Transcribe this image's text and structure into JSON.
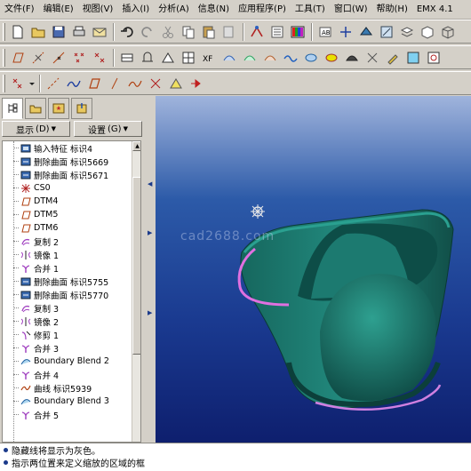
{
  "menu": [
    "文件(F)",
    "编辑(E)",
    "视图(V)",
    "插入(I)",
    "分析(A)",
    "信息(N)",
    "应用程序(P)",
    "工具(T)",
    "窗口(W)",
    "帮助(H)",
    "EMX 4.1"
  ],
  "panel": {
    "display_label": "显示",
    "display_accel": "(D)",
    "settings_label": "设置",
    "settings_accel": "(G)"
  },
  "tree": [
    {
      "label": "输入特征 标识4",
      "icon": "import-feature-icon"
    },
    {
      "label": "删除曲面 标识5669",
      "icon": "delete-surface-icon"
    },
    {
      "label": "删除曲面 标识5671",
      "icon": "delete-surface-icon"
    },
    {
      "label": "CS0",
      "icon": "coordinate-system-icon"
    },
    {
      "label": "DTM4",
      "icon": "datum-plane-icon"
    },
    {
      "label": "DTM5",
      "icon": "datum-plane-icon"
    },
    {
      "label": "DTM6",
      "icon": "datum-plane-icon"
    },
    {
      "label": "复制 2",
      "icon": "copy-icon"
    },
    {
      "label": "镜像 1",
      "icon": "mirror-icon"
    },
    {
      "label": "合并 1",
      "icon": "merge-icon"
    },
    {
      "label": "删除曲面 标识5755",
      "icon": "delete-surface-icon"
    },
    {
      "label": "删除曲面 标识5770",
      "icon": "delete-surface-icon"
    },
    {
      "label": "复制 3",
      "icon": "copy-icon"
    },
    {
      "label": "镜像 2",
      "icon": "mirror-icon"
    },
    {
      "label": "修剪 1",
      "icon": "trim-icon"
    },
    {
      "label": "合并 3",
      "icon": "merge-icon"
    },
    {
      "label": "Boundary Blend 2",
      "icon": "boundary-blend-icon"
    },
    {
      "label": "合并 4",
      "icon": "merge-icon"
    },
    {
      "label": "曲线 标识5939",
      "icon": "curve-icon"
    },
    {
      "label": "Boundary Blend 3",
      "icon": "boundary-blend-icon"
    },
    {
      "label": "合并 5",
      "icon": "merge-icon"
    }
  ],
  "viewport": {
    "watermark": "cad2688.com",
    "surface_color": "#1f7d72",
    "highlight_color": "#e070e0"
  },
  "messages": [
    "隐藏线将显示为灰色。",
    "指示两位置来定义缩放的区域的框"
  ]
}
